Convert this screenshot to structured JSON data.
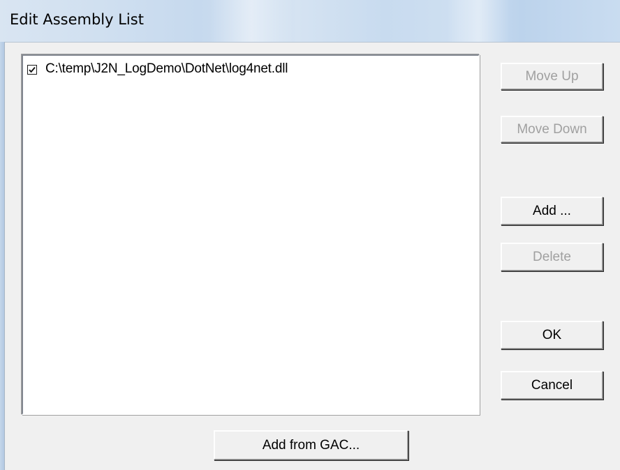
{
  "window": {
    "title": "Edit Assembly List"
  },
  "assembly_list": {
    "items": [
      {
        "path": "C:\\temp\\J2N_LogDemo\\DotNet\\log4net.dll",
        "checked": true
      }
    ]
  },
  "buttons": {
    "move_up": {
      "label": "Move Up",
      "enabled": false
    },
    "move_down": {
      "label": "Move Down",
      "enabled": false
    },
    "add": {
      "label": "Add ...",
      "enabled": true
    },
    "delete": {
      "label": "Delete",
      "enabled": false
    },
    "ok": {
      "label": "OK",
      "enabled": true
    },
    "cancel": {
      "label": "Cancel",
      "enabled": true
    },
    "add_from_gac": {
      "label": "Add from GAC...",
      "enabled": true
    }
  },
  "colors": {
    "disabled_text": "#a0a0a0",
    "dialog_background": "#f0f0f0",
    "title_bar": "#cfdff0"
  }
}
